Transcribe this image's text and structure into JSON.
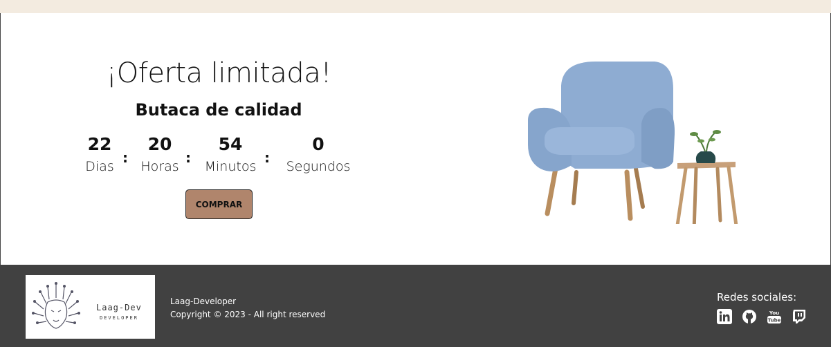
{
  "offer": {
    "title": "¡Oferta limitada!",
    "subtitle": "Butaca de calidad",
    "countdown": [
      {
        "value": "22",
        "label": "Dias"
      },
      {
        "value": "20",
        "label": "Horas"
      },
      {
        "value": "54",
        "label": "Minutos"
      },
      {
        "value": "0",
        "label": "Segundos"
      }
    ],
    "separator": ":",
    "buy_label": "COMPRAR"
  },
  "hero_image": {
    "icon": "armchair-with-side-table-icon"
  },
  "footer": {
    "logo": {
      "name": "Laag-Dev",
      "tagline": "DEVELOPER",
      "icon": "lion-circuit-logo-icon"
    },
    "brand": "Laag-Developer",
    "copyright": "Copyright © 2023 - All right reserved",
    "social_title": "Redes sociales:",
    "social_icons": [
      "linkedin-icon",
      "github-icon",
      "youtube-icon",
      "twitch-icon"
    ]
  },
  "colors": {
    "top_band": "#f3ebe0",
    "button": "#b0856c",
    "footer": "#414141",
    "chair": "#8fadd3"
  }
}
